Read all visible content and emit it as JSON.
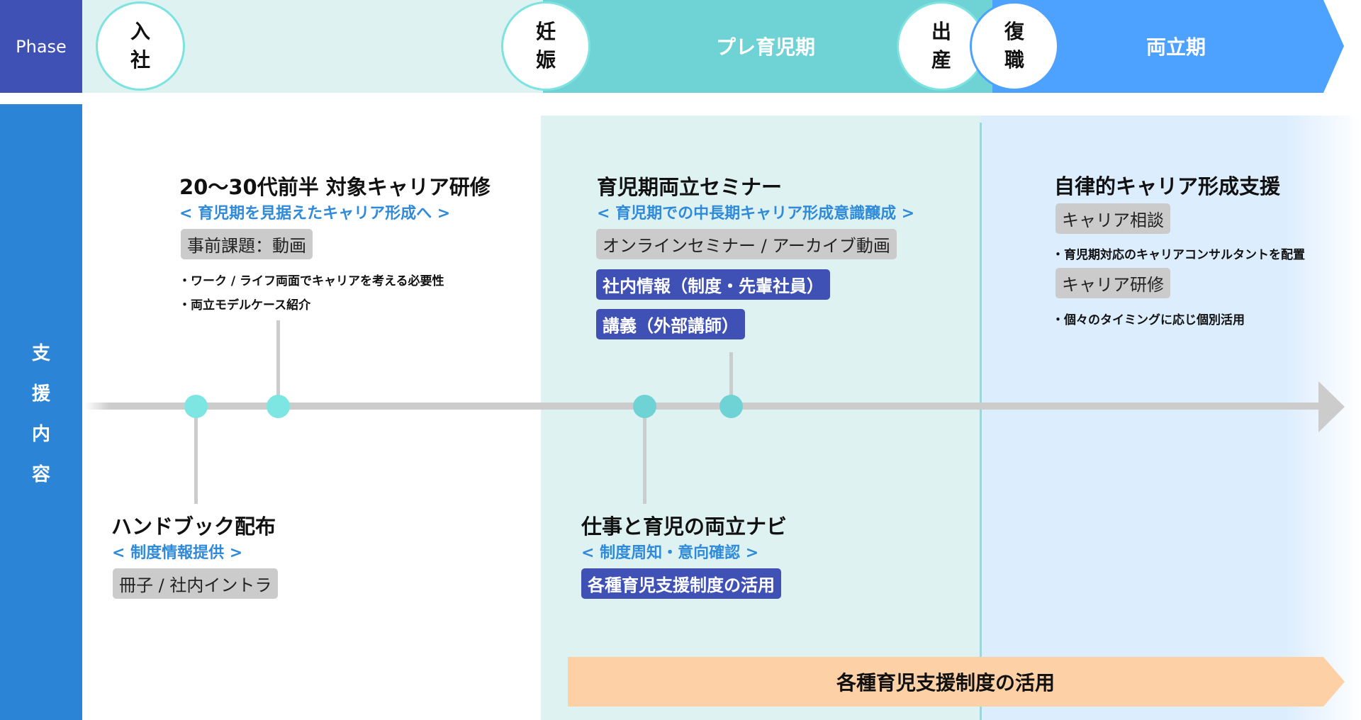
{
  "header": {
    "phase_label": "Phase",
    "milestones": [
      {
        "id": "join",
        "chars": [
          "入",
          "社"
        ]
      },
      {
        "id": "pregnancy",
        "chars": [
          "妊",
          "娠"
        ]
      },
      {
        "id": "birth",
        "chars": [
          "出",
          "産"
        ]
      },
      {
        "id": "return",
        "chars": [
          "復",
          "職"
        ]
      }
    ],
    "phases": [
      {
        "id": "pre-childcare",
        "label": "プレ育児期",
        "color": "#6fd3d6"
      },
      {
        "id": "balance",
        "label": "両立期",
        "color": "#4da2ff"
      }
    ]
  },
  "side": {
    "support_label_chars": [
      "支",
      "援",
      "内",
      "容"
    ]
  },
  "blocks": {
    "career_training": {
      "title": "20～30代前半 対象キャリア研修",
      "subtitle": "< 育児期を見据えたキャリア形成へ >",
      "tag": "事前課題：動画",
      "bullets": [
        "・ワーク / ライフ両面でキャリアを考える必要性",
        "・両立モデルケース紹介"
      ]
    },
    "seminar": {
      "title": "育児期両立セミナー",
      "subtitle": "< 育児期での中長期キャリア形成意識醸成 >",
      "tag_gray": "オンラインセミナー / アーカイブ動画",
      "tag_navy_1": "社内情報（制度・先輩社員）",
      "tag_navy_2": "講義（外部講師）"
    },
    "autonomous": {
      "title": "自律的キャリア形成支援",
      "tag_1": "キャリア相談",
      "bullet_1": "・育児期対応のキャリアコンサルタントを配置",
      "tag_2": "キャリア研修",
      "bullet_2": "・個々のタイミングに応じ個別活用"
    },
    "handbook": {
      "title": "ハンドブック配布",
      "subtitle": "< 制度情報提供 >",
      "tag": "冊子 / 社内イントラ"
    },
    "navi": {
      "title": "仕事と育児の両立ナビ",
      "subtitle": "< 制度周知・意向確認 >",
      "tag": "各種育児支援制度の活用"
    }
  },
  "band": {
    "label": "各種育児支援制度の活用",
    "color": "#fdd0a6"
  },
  "colors": {
    "navy": "#3f51b5",
    "side_blue": "#2b84d6",
    "accent_blue": "#2f8ad9",
    "teal_light": "#dff2f2",
    "blue_light": "#dcedfd"
  }
}
